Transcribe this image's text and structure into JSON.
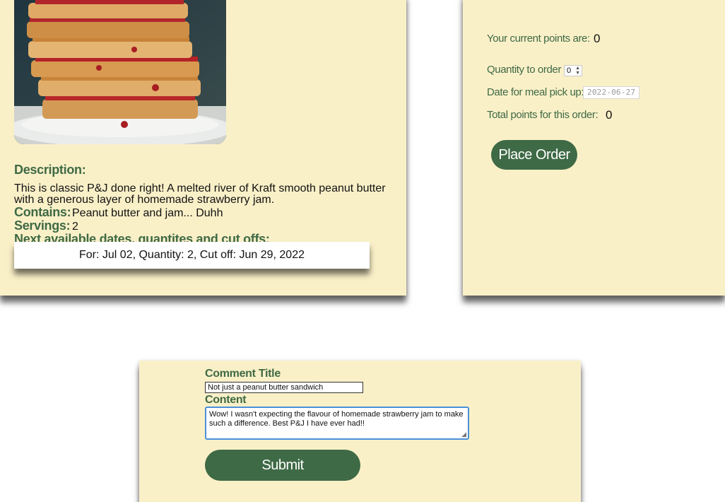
{
  "meal": {
    "description_label": "Description:",
    "description_text": "This is classic P&J done right! A melted river of Kraft smooth peanut butter with a generous layer of homemade strawberry jam.",
    "contains_label": "Contains:",
    "contains_value": "Peanut butter and jam... Duhh",
    "servings_label": "Servings:",
    "servings_value": "2",
    "next_dates_label": "Next available dates, quantites and cut offs:",
    "next_dates_entry": "For: Jul 02, Quantity: 2, Cut off: Jun 29, 2022"
  },
  "order": {
    "points_label": "Your current points are:",
    "points_value": "0",
    "quantity_label": "Quantity to order",
    "quantity_value": "0",
    "date_label": "Date for meal pick up:",
    "date_value": "2022-06-27",
    "total_label": "Total points for this order:",
    "total_value": "0",
    "place_order_label": "Place Order"
  },
  "comment": {
    "title_label": "Comment Title",
    "title_value": "Not just a peanut butter sandwich",
    "content_label": "Content",
    "content_value": "Wow! I wasn't expecting the flavour of homemade strawberry jam to make such a difference. Best P&J I have ever had!!",
    "submit_label": "Submit"
  },
  "colors": {
    "panel_bg": "#faf0c8",
    "accent_green": "#3e6a45"
  }
}
